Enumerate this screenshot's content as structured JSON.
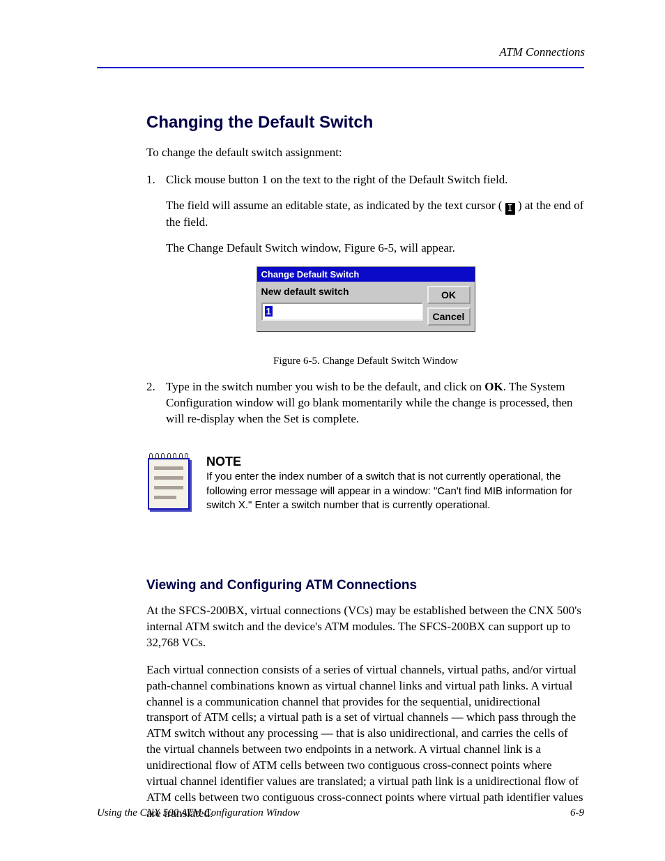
{
  "header": {
    "right": "ATM Connections"
  },
  "section": {
    "heading": "Changing the Default Switch",
    "intro": "To change the default switch assignment:",
    "step1": "Click mouse button 1 on the text to the right of the Default Switch field.",
    "step1_note_a": "The field will assume an editable state, as indicated by the text cursor (",
    "step1_note_b": ") at the end of the field.",
    "step1_figure": "The Change Default Switch window, Figure 6-5, will appear.",
    "step2_a": "Type in the switch number you wish to be the default, and click on ",
    "step2_b": ". The System Configuration window will go blank momentarily while the change is processed, then will re-display when the Set is complete.",
    "ok_ref": "OK",
    "figure_label": "Figure 6-5. Change Default Switch Window"
  },
  "dialog": {
    "title": "Change Default Switch",
    "label": "New default switch",
    "value": "1",
    "ok": "OK",
    "cancel": "Cancel"
  },
  "note": {
    "label": "NOTE",
    "text": "If you enter the index number of a switch that is not currently operational, the following error message will appear in a window: \"Can't find MIB information for switch X.\" Enter a switch number that is currently operational."
  },
  "subsection": {
    "heading": "Viewing and Configuring ATM Connections",
    "para1": "At the SFCS-200BX, virtual connections (VCs) may be established between the CNX 500's internal ATM switch and the device's ATM modules. The SFCS-200BX can support up to 32,768 VCs.",
    "para2": "Each virtual connection consists of a series of virtual channels, virtual paths, and/or virtual path-channel combinations known as virtual channel links and virtual path links. A virtual channel is a communication channel that provides for the sequential, unidirectional transport of ATM cells; a virtual path is a set of virtual channels — which pass through the ATM switch without any processing — that is also unidirectional, and carries the cells of the virtual channels between two endpoints in a network. A virtual channel link is a unidirectional flow of ATM cells between two contiguous cross-connect points where virtual channel identifier values are translated; a virtual path link is a unidirectional flow of ATM cells between two contiguous cross-connect points where virtual path identifier values are translated."
  },
  "footer": {
    "left": "Using the CNX 500 ATM Configuration Window",
    "right": "6-9"
  }
}
